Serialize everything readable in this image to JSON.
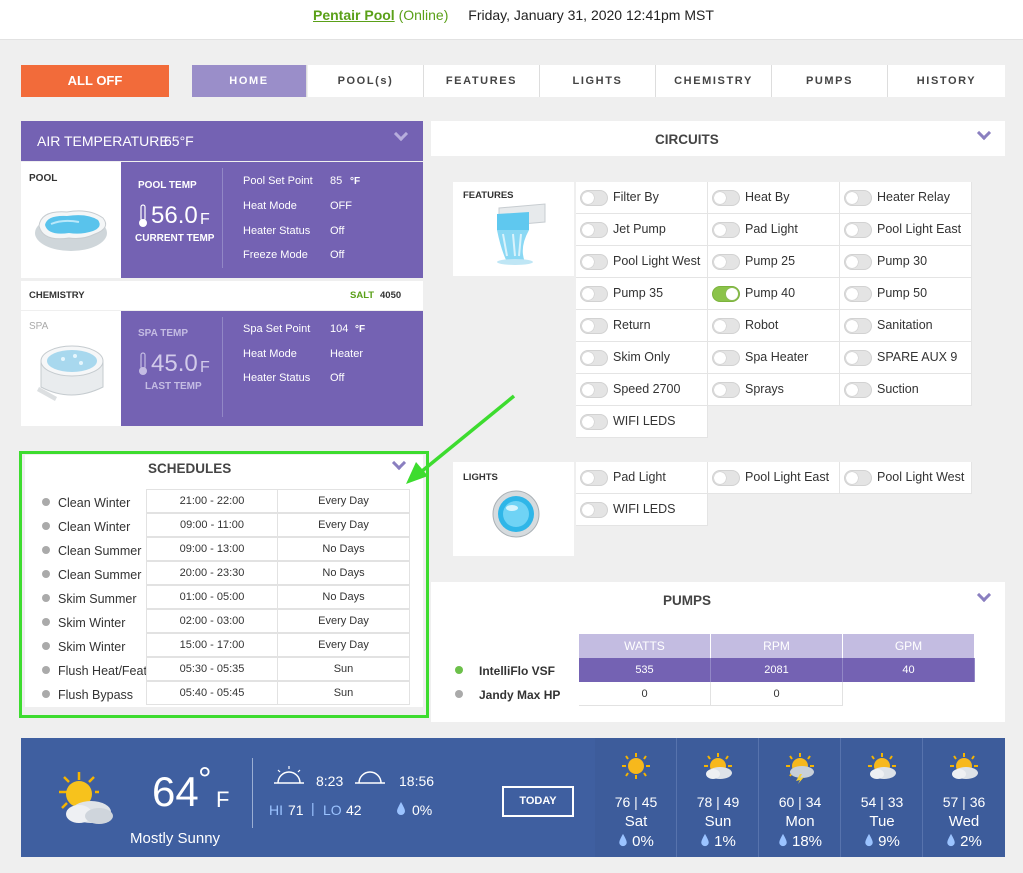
{
  "header": {
    "title": "Pentair Pool",
    "status": "(Online)",
    "datetime": "Friday, January 31, 2020 12:41pm MST"
  },
  "nav": {
    "all_off": "ALL OFF",
    "tabs": [
      "HOME",
      "POOL(s)",
      "FEATURES",
      "LIGHTS",
      "CHEMISTRY",
      "PUMPS",
      "HISTORY"
    ]
  },
  "air": {
    "title": "AIR TEMPERATURE",
    "value": "65°F"
  },
  "pool": {
    "label": "POOL",
    "temp_label": "POOL TEMP",
    "temp": "56.0",
    "unit": "F",
    "temp_sub": "CURRENT TEMP",
    "rows": [
      [
        "Pool Set Point",
        "85"
      ],
      [
        "Heat Mode",
        "OFF"
      ],
      [
        "Heater Status",
        "Off"
      ],
      [
        "Freeze Mode",
        "Off"
      ]
    ],
    "setpoint_unit": "°F"
  },
  "chemistry": {
    "label": "CHEMISTRY",
    "salt_label": "SALT",
    "salt": "4050"
  },
  "spa": {
    "label": "SPA",
    "temp_label": "SPA TEMP",
    "temp": "45.0",
    "unit": "F",
    "temp_sub": "LAST TEMP",
    "rows": [
      [
        "Spa Set Point",
        "104"
      ],
      [
        "Heat Mode",
        "Heater"
      ],
      [
        "Heater Status",
        "Off"
      ]
    ],
    "setpoint_unit": "°F"
  },
  "schedules": {
    "title": "SCHEDULES",
    "rows": [
      [
        "Clean Winter",
        "21:00 - 22:00",
        "Every Day"
      ],
      [
        "Clean Winter",
        "09:00 - 11:00",
        "Every Day"
      ],
      [
        "Clean Summer",
        "09:00 - 13:00",
        "No Days"
      ],
      [
        "Clean Summer",
        "20:00 - 23:30",
        "No Days"
      ],
      [
        "Skim Summer",
        "01:00 - 05:00",
        "No Days"
      ],
      [
        "Skim Winter",
        "02:00 - 03:00",
        "Every Day"
      ],
      [
        "Skim Winter",
        "15:00 - 17:00",
        "Every Day"
      ],
      [
        "Flush Heat/Feat",
        "05:30 - 05:35",
        "Sun"
      ],
      [
        "Flush Bypass",
        "05:40 - 05:45",
        "Sun"
      ]
    ]
  },
  "circuits": {
    "title": "CIRCUITS",
    "features_label": "FEATURES",
    "features": [
      {
        "name": "Filter By",
        "on": false
      },
      {
        "name": "Heat By",
        "on": false
      },
      {
        "name": "Heater Relay",
        "on": false
      },
      {
        "name": "Jet Pump",
        "on": false
      },
      {
        "name": "Pad Light",
        "on": false
      },
      {
        "name": "Pool Light East",
        "on": false
      },
      {
        "name": "Pool Light West",
        "on": false
      },
      {
        "name": "Pump 25",
        "on": false
      },
      {
        "name": "Pump 30",
        "on": false
      },
      {
        "name": "Pump 35",
        "on": false
      },
      {
        "name": "Pump 40",
        "on": true
      },
      {
        "name": "Pump 50",
        "on": false
      },
      {
        "name": "Return",
        "on": false
      },
      {
        "name": "Robot",
        "on": false
      },
      {
        "name": "Sanitation",
        "on": false
      },
      {
        "name": "Skim Only",
        "on": false
      },
      {
        "name": "Spa Heater",
        "on": false
      },
      {
        "name": "SPARE AUX 9",
        "on": false
      },
      {
        "name": "Speed 2700",
        "on": false
      },
      {
        "name": "Sprays",
        "on": false
      },
      {
        "name": "Suction",
        "on": false
      },
      {
        "name": "WIFI LEDS",
        "on": false
      }
    ],
    "lights_label": "LIGHTS",
    "lights": [
      {
        "name": "Pad Light",
        "on": false
      },
      {
        "name": "Pool Light East",
        "on": false
      },
      {
        "name": "Pool Light West",
        "on": false
      },
      {
        "name": "WIFI LEDS",
        "on": false
      }
    ]
  },
  "pumps": {
    "title": "PUMPS",
    "headers": [
      "WATTS",
      "RPM",
      "GPM"
    ],
    "rows": [
      {
        "name": "IntelliFlo VSF",
        "active": true,
        "values": [
          "535",
          "2081",
          "40"
        ]
      },
      {
        "name": "Jandy Max HP",
        "active": false,
        "values": [
          "0",
          "0"
        ]
      }
    ]
  },
  "weather": {
    "temp": "64",
    "unit": "°",
    "unit_letter": "F",
    "condition": "Mostly Sunny",
    "sunrise": "8:23",
    "sunset": "18:56",
    "hi_label": "HI",
    "hi": "71",
    "lo_label": "LO",
    "lo": "42",
    "precip": "0%",
    "today_button": "TODAY",
    "forecast": [
      {
        "temps": "76 | 45",
        "day": "Sat",
        "precip": "0%",
        "icon": "sun"
      },
      {
        "temps": "78 | 49",
        "day": "Sun",
        "precip": "1%",
        "icon": "sun-cloud"
      },
      {
        "temps": "60 | 34",
        "day": "Mon",
        "precip": "18%",
        "icon": "thunder-cloud"
      },
      {
        "temps": "54 | 33",
        "day": "Tue",
        "precip": "9%",
        "icon": "sun-cloud"
      },
      {
        "temps": "57 | 36",
        "day": "Wed",
        "precip": "2%",
        "icon": "sun-cloud"
      }
    ]
  },
  "colors": {
    "accent": "#7462b3",
    "all_off": "#f26b3a",
    "online": "#5aa018",
    "weather_bg": "#3f5fa0",
    "highlight": "#3ddc2f"
  }
}
